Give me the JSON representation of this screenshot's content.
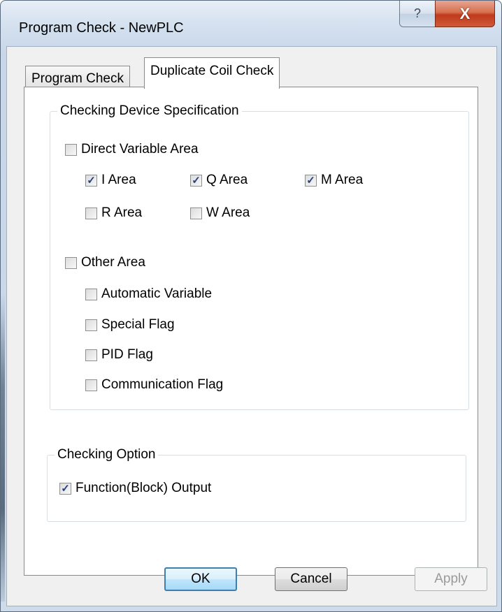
{
  "window": {
    "title": "Program Check - NewPLC",
    "help_glyph": "?",
    "close_glyph": "X"
  },
  "tabs": [
    {
      "label": "Program Check",
      "active": false
    },
    {
      "label": "Duplicate Coil Check",
      "active": true
    }
  ],
  "device_spec": {
    "legend": "Checking Device Specification",
    "direct": {
      "label": "Direct Variable Area",
      "checked": false
    },
    "direct_items": [
      {
        "label": "I Area",
        "checked": true
      },
      {
        "label": "Q Area",
        "checked": true
      },
      {
        "label": "M Area",
        "checked": true
      },
      {
        "label": "R Area",
        "checked": false
      },
      {
        "label": "W Area",
        "checked": false
      }
    ],
    "other": {
      "label": "Other Area",
      "checked": false
    },
    "other_items": [
      {
        "label": "Automatic Variable",
        "checked": false
      },
      {
        "label": "Special Flag",
        "checked": false
      },
      {
        "label": "PID Flag",
        "checked": false
      },
      {
        "label": "Communication Flag",
        "checked": false
      }
    ]
  },
  "checking_option": {
    "legend": "Checking Option",
    "function_output": {
      "label": "Function(Block) Output",
      "checked": true
    }
  },
  "buttons": {
    "ok": "OK",
    "cancel": "Cancel",
    "apply": "Apply"
  },
  "check_glyph": "✓",
  "colors": {
    "close_red": "#c0391c",
    "check_blue": "#26407b",
    "ok_border": "#3c7fb1"
  }
}
